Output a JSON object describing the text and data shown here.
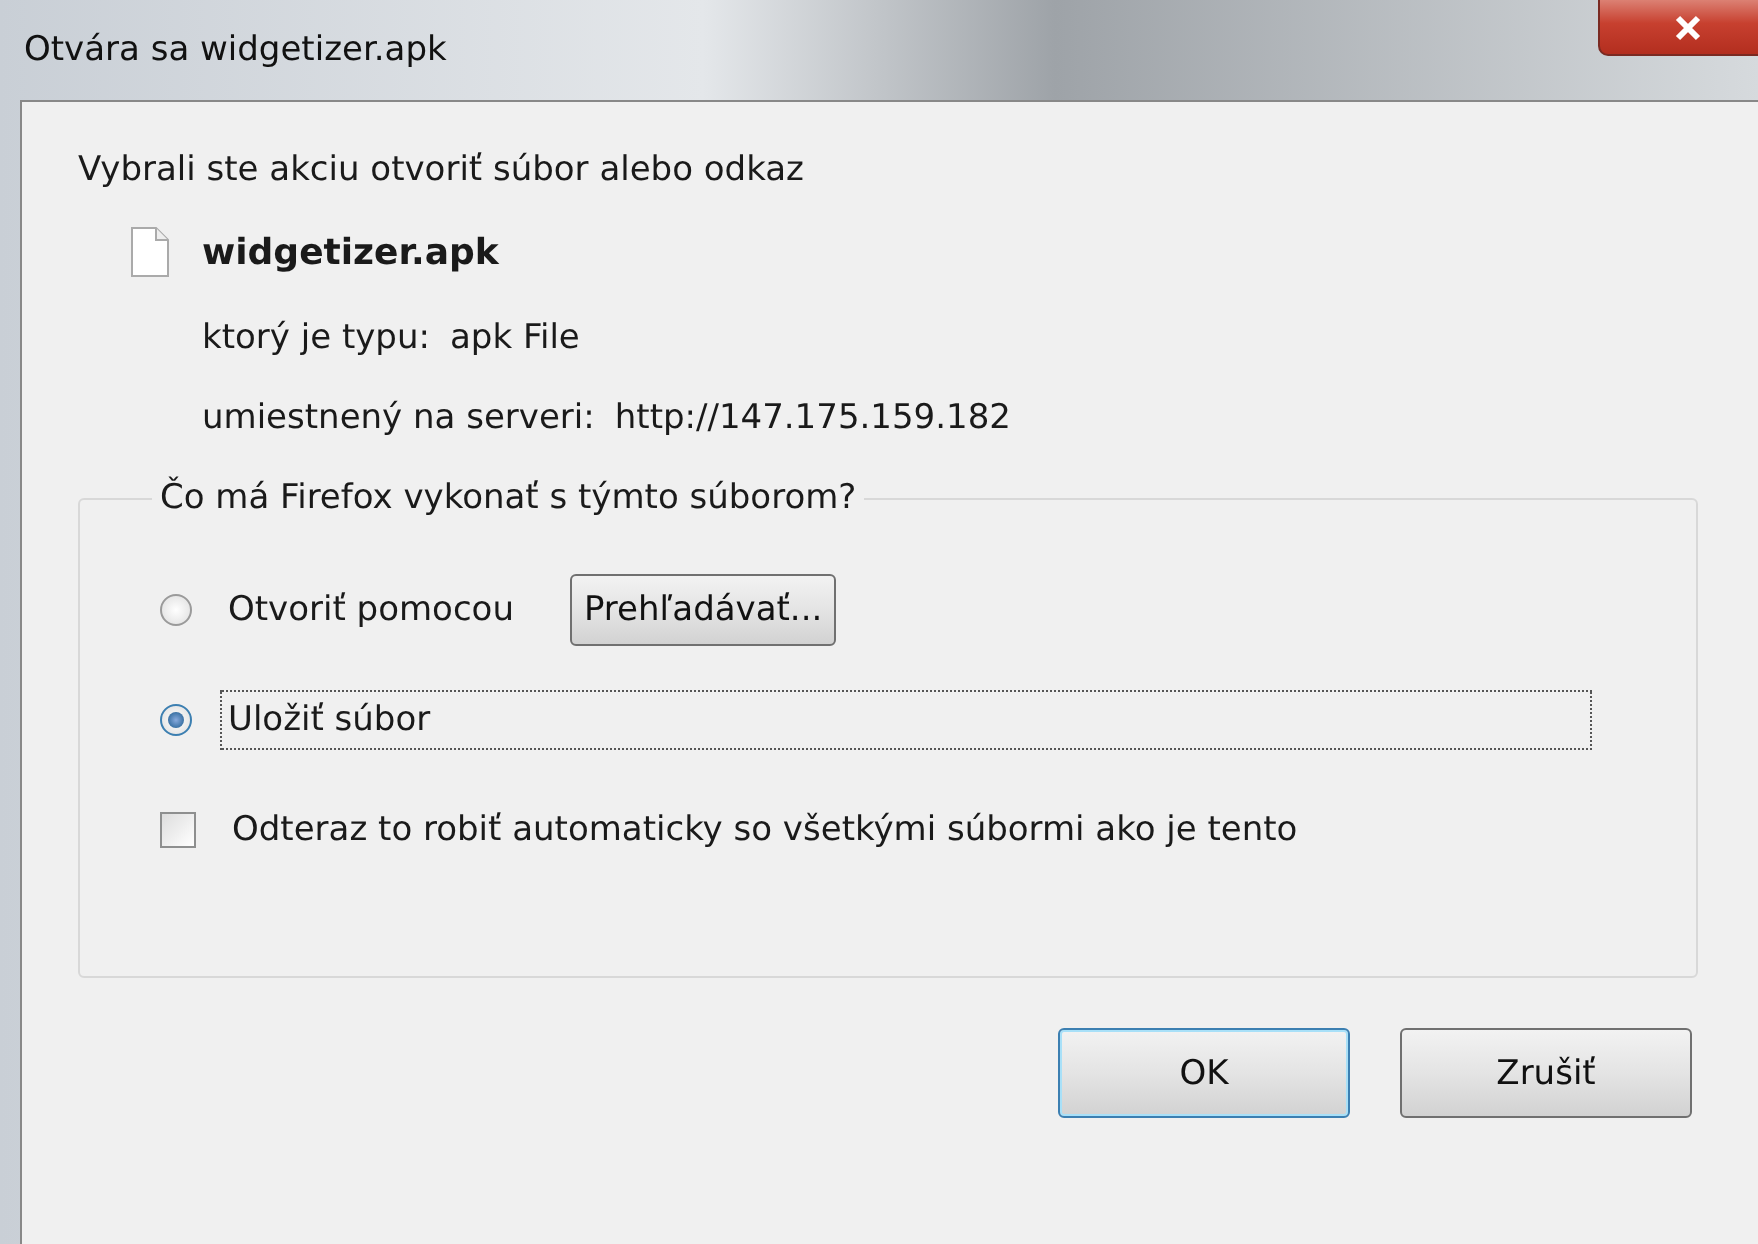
{
  "window": {
    "title": "Otvára sa widgetizer.apk"
  },
  "intro": "Vybrali ste akciu otvoriť súbor alebo odkaz",
  "file": {
    "name": "widgetizer.apk",
    "details": [
      {
        "label": "ktorý je typu:",
        "value": "apk File"
      },
      {
        "label": "umiestnený na serveri:",
        "value": "http://147.175.159.182"
      }
    ]
  },
  "group": {
    "legend": "Čo má Firefox vykonať s týmto súborom?",
    "options": [
      {
        "label": "Otvoriť pomocou",
        "selected": false,
        "focused": false,
        "button": "Prehľadávať..."
      },
      {
        "label": "Uložiť súbor",
        "selected": true,
        "focused": true
      }
    ],
    "checkbox": {
      "label": "Odteraz to robiť automaticky so všetkými súbormi ako je tento",
      "checked": false
    }
  },
  "buttons": [
    {
      "label": "OK",
      "default": true
    },
    {
      "label": "Zrušiť",
      "default": false
    }
  ]
}
